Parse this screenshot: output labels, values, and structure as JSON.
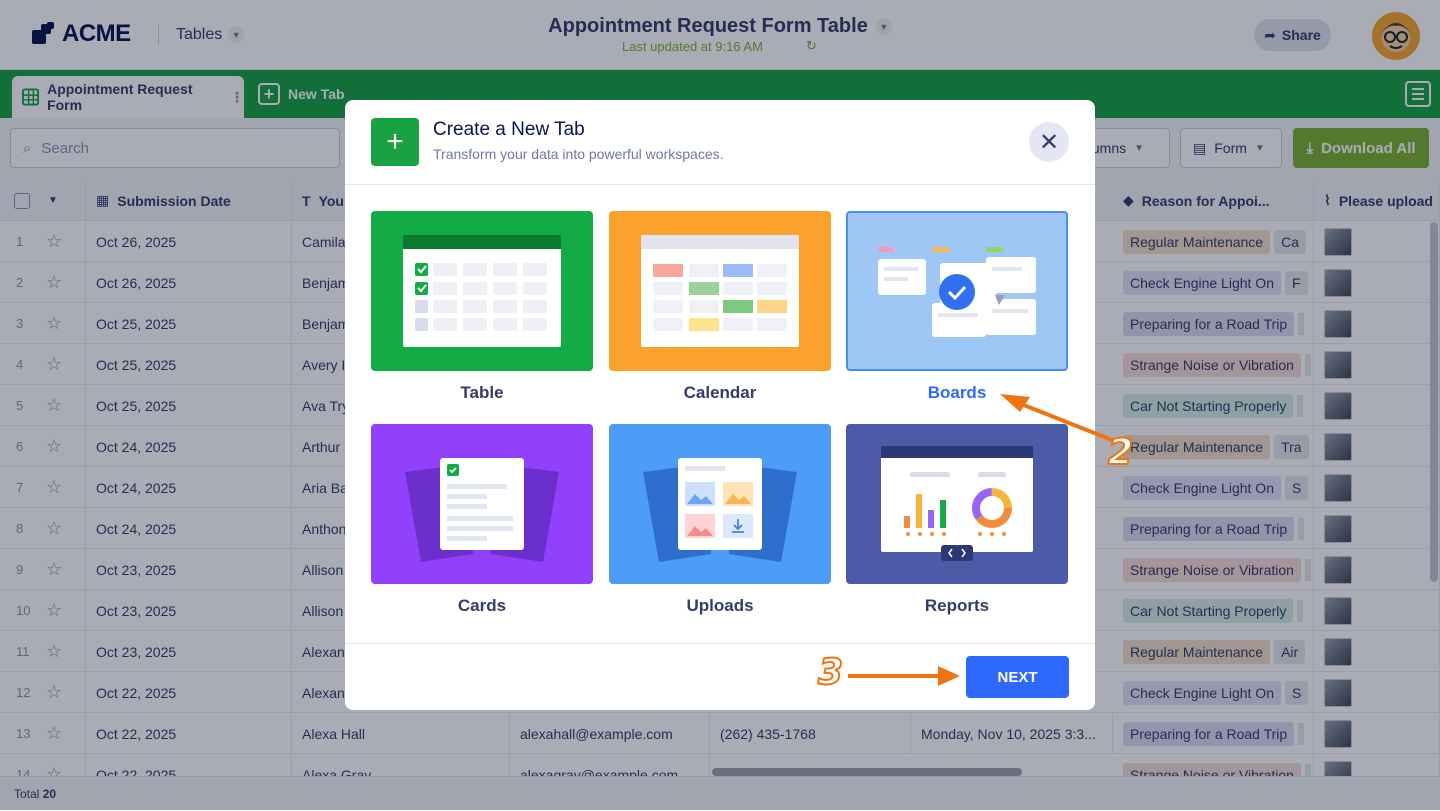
{
  "header": {
    "logo": "ACME",
    "tables_label": "Tables",
    "title": "Appointment Request Form Table",
    "updated": "Last updated at 9:16 AM",
    "share": "Share"
  },
  "tabs": {
    "active": "Appointment Request Form",
    "new": "New Tab"
  },
  "toolbar": {
    "search_placeholder": "Search",
    "columns": "olumns",
    "form": "Form",
    "download": "Download All"
  },
  "columns": [
    "Submission Date",
    "You",
    "Reason for Appoi...",
    "Please upload"
  ],
  "rows": [
    {
      "n": "1",
      "date": "Oct 26, 2025",
      "name": "Camila",
      "reason": "Regular Maintenance",
      "reason_color": "#f3ddc8",
      "extra": "Ca"
    },
    {
      "n": "2",
      "date": "Oct 26, 2025",
      "name": "Benjam",
      "reason": "Check Engine Light On",
      "reason_color": "#e4e1f5",
      "extra": "F"
    },
    {
      "n": "3",
      "date": "Oct 25, 2025",
      "name": "Benjam",
      "reason": "Preparing for a Road Trip",
      "reason_color": "#ddd9f2",
      "extra": ""
    },
    {
      "n": "4",
      "date": "Oct 25, 2025",
      "name": "Avery I",
      "reason": "Strange Noise or Vibration",
      "reason_color": "#f7dcd9",
      "extra": ""
    },
    {
      "n": "5",
      "date": "Oct 25, 2025",
      "name": "Ava Try",
      "reason": "Car Not Starting Properly",
      "reason_color": "#d6efe4",
      "extra": ""
    },
    {
      "n": "6",
      "date": "Oct 24, 2025",
      "name": "Arthur",
      "reason": "Regular Maintenance",
      "reason_color": "#f3ddc8",
      "extra": "Tra"
    },
    {
      "n": "7",
      "date": "Oct 24, 2025",
      "name": "Aria Ba",
      "reason": "Check Engine Light On",
      "reason_color": "#e4e1f5",
      "extra": "S"
    },
    {
      "n": "8",
      "date": "Oct 24, 2025",
      "name": "Anthon",
      "reason": "Preparing for a Road Trip",
      "reason_color": "#ddd9f2",
      "extra": ""
    },
    {
      "n": "9",
      "date": "Oct 23, 2025",
      "name": "Allison",
      "reason": "Strange Noise or Vibration",
      "reason_color": "#f7dcd9",
      "extra": ""
    },
    {
      "n": "10",
      "date": "Oct 23, 2025",
      "name": "Allison",
      "reason": "Car Not Starting Properly",
      "reason_color": "#d6efe4",
      "extra": ""
    },
    {
      "n": "11",
      "date": "Oct 23, 2025",
      "name": "Alexan",
      "reason": "Regular Maintenance",
      "reason_color": "#f3ddc8",
      "extra": "Air"
    },
    {
      "n": "12",
      "date": "Oct 22, 2025",
      "name": "Alexan",
      "reason": "Check Engine Light On",
      "reason_color": "#e4e1f5",
      "extra": "S"
    },
    {
      "n": "13",
      "date": "Oct 22, 2025",
      "name": "Alexa Hall",
      "email": "alexahall@example.com",
      "phone": "(262) 435-1768",
      "appt": "Monday, Nov 10, 2025 3:3...",
      "reason": "Preparing for a Road Trip",
      "reason_color": "#ddd9f2",
      "extra": ""
    },
    {
      "n": "14",
      "date": "Oct 22, 2025",
      "name": "Alexa Gray",
      "email": "alexagray@example.com",
      "reason": "Strange Noise or Vibration",
      "reason_color": "#f7dcd9",
      "extra": ""
    }
  ],
  "footer": {
    "label": "Total",
    "count": "20"
  },
  "modal": {
    "title": "Create a New Tab",
    "subtitle": "Transform your data into powerful workspaces.",
    "options": [
      "Table",
      "Calendar",
      "Boards",
      "Cards",
      "Uploads",
      "Reports"
    ],
    "selected": "Boards",
    "next": "NEXT"
  },
  "annotations": [
    "2",
    "3"
  ],
  "colors": {
    "green": "#18a243",
    "blue": "#2e69ff",
    "orange": "#f0730f",
    "navy": "#0a1551"
  }
}
